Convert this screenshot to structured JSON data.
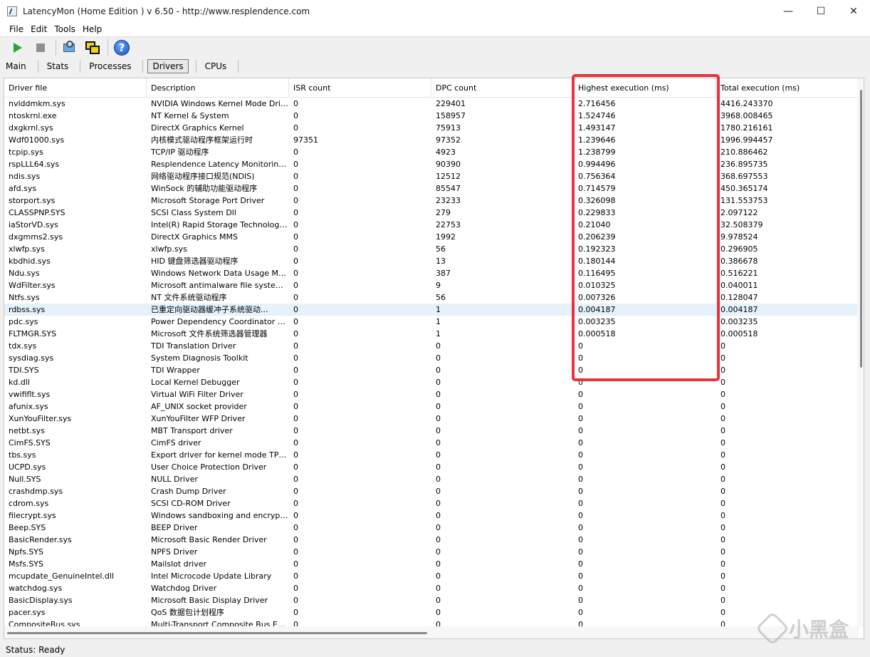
{
  "window": {
    "title": "LatencyMon  (Home Edition )  v 6.50 - http://www.resplendence.com",
    "minimize": "—",
    "maximize": "☐",
    "close": "✕"
  },
  "menu": [
    "File",
    "Edit",
    "Tools",
    "Help"
  ],
  "toolbar": {
    "icons": [
      "play-icon",
      "stop-icon",
      "search-icon",
      "windows-icon",
      "help-icon"
    ],
    "help_glyph": "?"
  },
  "tabs": [
    "Main",
    "Stats",
    "Processes",
    "Drivers",
    "CPUs"
  ],
  "active_tab": "Drivers",
  "table": {
    "columns": [
      "Driver file",
      "Description",
      "ISR count",
      "DPC count",
      "Highest execution (ms)",
      "Total execution (ms)"
    ],
    "selected_row": 17,
    "rows": [
      [
        "nvlddmkm.sys",
        "NVIDIA Windows Kernel Mode Drive...",
        "0",
        "229401",
        "2.716456",
        "4416.243370"
      ],
      [
        "ntoskrnl.exe",
        "NT Kernel & System",
        "0",
        "158957",
        "1.524746",
        "3968.008465"
      ],
      [
        "dxgkrnl.sys",
        "DirectX Graphics Kernel",
        "0",
        "75913",
        "1.493147",
        "1780.216161"
      ],
      [
        "Wdf01000.sys",
        "内核模式驱动程序框架运行时",
        "97351",
        "97352",
        "1.239646",
        "1996.994457"
      ],
      [
        "tcpip.sys",
        "TCP/IP 驱动程序",
        "0",
        "4923",
        "1.238799",
        "210.886462"
      ],
      [
        "rspLLL64.sys",
        "Resplendence Latency Monitoring a...",
        "0",
        "90390",
        "0.994496",
        "236.895735"
      ],
      [
        "ndis.sys",
        "网络驱动程序接口规范(NDIS)",
        "0",
        "12512",
        "0.756364",
        "368.697553"
      ],
      [
        "afd.sys",
        "WinSock 的辅助功能驱动程序",
        "0",
        "85547",
        "0.714579",
        "450.365174"
      ],
      [
        "storport.sys",
        "Microsoft Storage Port Driver",
        "0",
        "23233",
        "0.326098",
        "131.553753"
      ],
      [
        "CLASSPNP.SYS",
        "SCSI Class System Dll",
        "0",
        "279",
        "0.229833",
        "2.097122"
      ],
      [
        "iaStorVD.sys",
        "Intel(R) Rapid Storage Technology ...",
        "0",
        "22753",
        "0.21040",
        "32.508379"
      ],
      [
        "dxgmms2.sys",
        "DirectX Graphics MMS",
        "0",
        "1992",
        "0.206239",
        "9.978524"
      ],
      [
        "xlwfp.sys",
        "xlwfp.sys",
        "0",
        "56",
        "0.192323",
        "0.296905"
      ],
      [
        "kbdhid.sys",
        "HID 键盘筛选器驱动程序",
        "0",
        "13",
        "0.180144",
        "0.386678"
      ],
      [
        "Ndu.sys",
        "Windows Network Data Usage Monit...",
        "0",
        "387",
        "0.116495",
        "0.516221"
      ],
      [
        "WdFilter.sys",
        "Microsoft antimalware file system filt...",
        "0",
        "9",
        "0.010325",
        "0.040011"
      ],
      [
        "Ntfs.sys",
        "NT 文件系统驱动程序",
        "0",
        "56",
        "0.007326",
        "0.128047"
      ],
      [
        "rdbss.sys",
        "已重定向驱动器缓冲子系统驱动...",
        "0",
        "1",
        "0.004187",
        "0.004187"
      ],
      [
        "pdc.sys",
        "Power Dependency Coordinator Driver",
        "0",
        "1",
        "0.003235",
        "0.003235"
      ],
      [
        "FLTMGR.SYS",
        "Microsoft 文件系统筛选器管理器",
        "0",
        "1",
        "0.000518",
        "0.000518"
      ],
      [
        "tdx.sys",
        "TDI Translation Driver",
        "0",
        "0",
        "0",
        "0"
      ],
      [
        "sysdiag.sys",
        "System Diagnosis Toolkit",
        "0",
        "0",
        "0",
        "0"
      ],
      [
        "TDI.SYS",
        "TDI Wrapper",
        "0",
        "0",
        "0",
        "0"
      ],
      [
        "kd.dll",
        "Local Kernel Debugger",
        "0",
        "0",
        "0",
        "0"
      ],
      [
        "vwififlt.sys",
        "Virtual WiFi Filter Driver",
        "0",
        "0",
        "0",
        "0"
      ],
      [
        "afunix.sys",
        "AF_UNIX socket provider",
        "0",
        "0",
        "0",
        "0"
      ],
      [
        "XunYouFilter.sys",
        "XunYouFilter WFP Driver",
        "0",
        "0",
        "0",
        "0"
      ],
      [
        "netbt.sys",
        "MBT Transport driver",
        "0",
        "0",
        "0",
        "0"
      ],
      [
        "CimFS.SYS",
        "CimFS driver",
        "0",
        "0",
        "0",
        "0"
      ],
      [
        "tbs.sys",
        "Export driver for kernel mode TPM API",
        "0",
        "0",
        "0",
        "0"
      ],
      [
        "UCPD.sys",
        "User Choice Protection Driver",
        "0",
        "0",
        "0",
        "0"
      ],
      [
        "Null.SYS",
        "NULL Driver",
        "0",
        "0",
        "0",
        "0"
      ],
      [
        "crashdmp.sys",
        "Crash Dump Driver",
        "0",
        "0",
        "0",
        "0"
      ],
      [
        "cdrom.sys",
        "SCSI CD-ROM Driver",
        "0",
        "0",
        "0",
        "0"
      ],
      [
        "filecrypt.sys",
        "Windows sandboxing and encryptio...",
        "0",
        "0",
        "0",
        "0"
      ],
      [
        "Beep.SYS",
        "BEEP Driver",
        "0",
        "0",
        "0",
        "0"
      ],
      [
        "BasicRender.sys",
        "Microsoft Basic Render Driver",
        "0",
        "0",
        "0",
        "0"
      ],
      [
        "Npfs.SYS",
        "NPFS Driver",
        "0",
        "0",
        "0",
        "0"
      ],
      [
        "Msfs.SYS",
        "Mailslot driver",
        "0",
        "0",
        "0",
        "0"
      ],
      [
        "mcupdate_GenuineIntel.dll",
        "Intel Microcode Update Library",
        "0",
        "0",
        "0",
        "0"
      ],
      [
        "watchdog.sys",
        "Watchdog Driver",
        "0",
        "0",
        "0",
        "0"
      ],
      [
        "BasicDisplay.sys",
        "Microsoft Basic Display Driver",
        "0",
        "0",
        "0",
        "0"
      ],
      [
        "pacer.sys",
        "QoS 数据包计划程序",
        "0",
        "0",
        "0",
        "0"
      ],
      [
        "CompositeBus.sys",
        "Multi-Transport Composite Bus Enu...",
        "0",
        "0",
        "0",
        "0"
      ]
    ]
  },
  "status": "Status: Ready",
  "watermark": "小黑盒",
  "colors": {
    "highlight": "#e8323c",
    "selected_row": "#e5f1fb"
  }
}
